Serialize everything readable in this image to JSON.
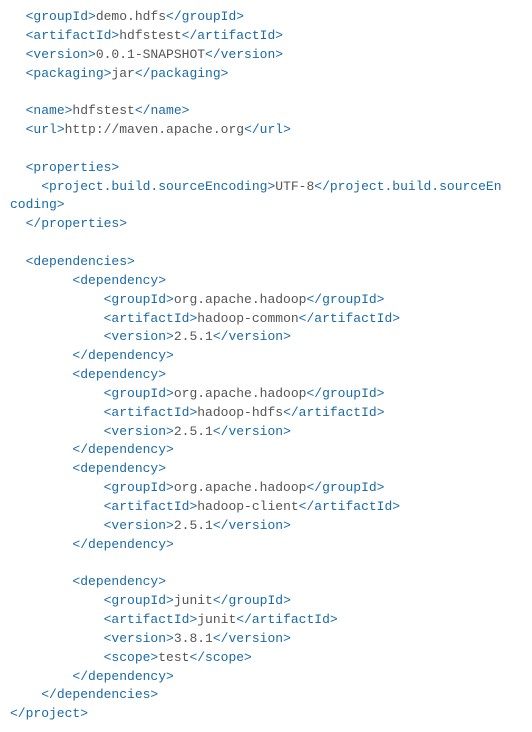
{
  "pom": {
    "groupId": "demo.hdfs",
    "artifactId": "hdfstest",
    "version": "0.0.1-SNAPSHOT",
    "packaging": "jar",
    "name": "hdfstest",
    "url": "http://maven.apache.org",
    "properties": {
      "sourceEncoding": "UTF-8"
    },
    "dependencies": [
      {
        "groupId": "org.apache.hadoop",
        "artifactId": "hadoop-common",
        "version": "2.5.1"
      },
      {
        "groupId": "org.apache.hadoop",
        "artifactId": "hadoop-hdfs",
        "version": "2.5.1"
      },
      {
        "groupId": "org.apache.hadoop",
        "artifactId": "hadoop-client",
        "version": "2.5.1"
      },
      {
        "groupId": "junit",
        "artifactId": "junit",
        "version": "3.8.1",
        "scope": "test"
      }
    ]
  },
  "tags": {
    "groupId_o": "<groupId>",
    "groupId_c": "</groupId>",
    "artifact_o": "<artifactId>",
    "artifact_c": "</artifactId>",
    "version_o": "<version>",
    "version_c": "</version>",
    "packaging_o": "<packaging>",
    "packaging_c": "</packaging>",
    "name_o": "<name>",
    "name_c": "</name>",
    "url_o": "<url>",
    "url_c": "</url>",
    "props_o": "<properties>",
    "props_c": "</properties>",
    "enc_o": "<project.build.sourceEncoding>",
    "enc_c": "</project.build.sourceEn",
    "enc_c2": "coding>",
    "deps_o": "<dependencies>",
    "deps_c": "</dependencies>",
    "dep_o": "<dependency>",
    "dep_c": "</dependency>",
    "scope_o": "<scope>",
    "scope_c": "</scope>",
    "proj_c": "</project>"
  },
  "ind": {
    "i1": "  ",
    "i2": "    ",
    "i3": "        ",
    "i4": "            "
  }
}
